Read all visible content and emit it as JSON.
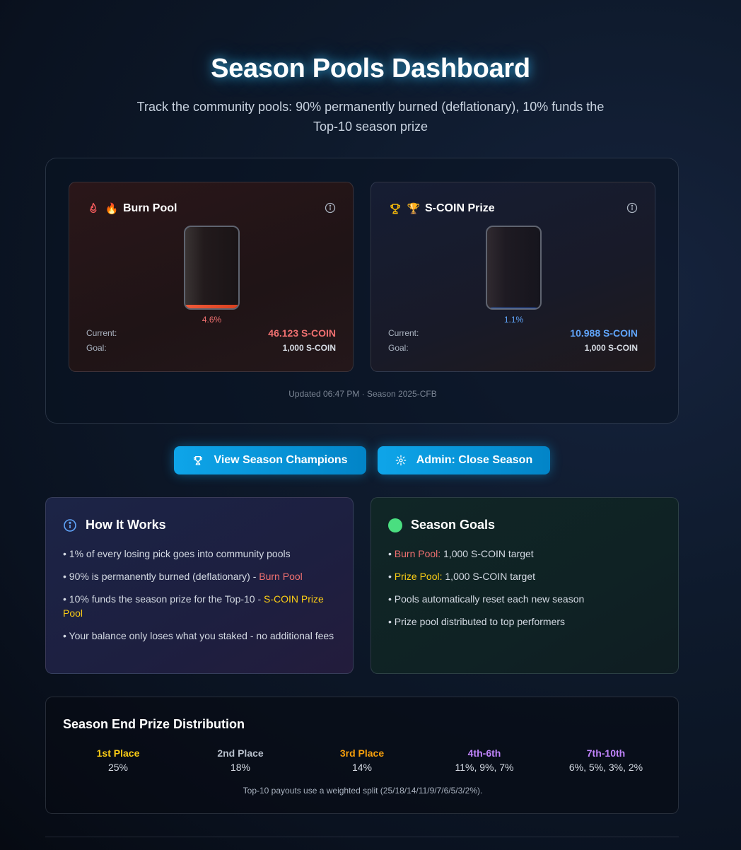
{
  "header": {
    "title": "Season Pools Dashboard",
    "subtitle": "Track the community pools: 90% permanently burned (deflationary), 10% funds the Top-10 season prize"
  },
  "pools": {
    "burn": {
      "icon": "flame-icon",
      "emoji": "🔥",
      "name": "Burn Pool",
      "fill_percent": 4.6,
      "percent_label": "4.6%",
      "current_label": "Current:",
      "current_value": "46.123 S-COIN",
      "goal_label": "Goal:",
      "goal_value": "1,000 S-COIN",
      "accent": "#f07070"
    },
    "prize": {
      "icon": "trophy-icon",
      "emoji": "🏆",
      "name": "S-COIN Prize",
      "fill_percent": 1.1,
      "percent_label": "1.1%",
      "current_label": "Current:",
      "current_value": "10.988 S-COIN",
      "goal_label": "Goal:",
      "goal_value": "1,000 S-COIN",
      "accent": "#60a5fa"
    },
    "updated": "Updated 06:47 PM · Season 2025-CFB"
  },
  "actions": {
    "champions_label": "View Season Champions",
    "admin_label": "Admin: Close Season"
  },
  "how_it_works": {
    "title": "How It Works",
    "items": [
      {
        "text": "• 1% of every losing pick goes into community pools"
      },
      {
        "text": "• 90% is permanently burned (deflationary) - ",
        "highlight": "Burn Pool"
      },
      {
        "text": "• 10% funds the season prize for the Top-10 - ",
        "highlight": "S-COIN Prize Pool"
      },
      {
        "text": "• Your balance only loses what you staked - no additional fees"
      }
    ]
  },
  "season_goals": {
    "title": "Season Goals",
    "items": [
      {
        "prefix": "• ",
        "highlight": "Burn Pool:",
        "text": " 1,000 S-COIN target"
      },
      {
        "prefix": "• ",
        "highlight": "Prize Pool:",
        "text": " 1,000 S-COIN target"
      },
      {
        "text": "• Pools automatically reset each new season"
      },
      {
        "text": "• Prize pool distributed to top performers"
      }
    ]
  },
  "distribution": {
    "title": "Season End Prize Distribution",
    "tiers": [
      {
        "place": "1st Place",
        "share": "25%",
        "color": "#facc15"
      },
      {
        "place": "2nd Place",
        "share": "18%",
        "color": "#b8c0cc"
      },
      {
        "place": "3rd Place",
        "share": "14%",
        "color": "#f59e0b"
      },
      {
        "place": "4th-6th",
        "share": "11%, 9%, 7%",
        "color": "#c084fc"
      },
      {
        "place": "7th-10th",
        "share": "6%, 5%, 3%, 2%",
        "color": "#c084fc"
      }
    ],
    "note": "Top-10 payouts use a weighted split (25/18/14/11/9/7/6/5/3/2%)."
  }
}
